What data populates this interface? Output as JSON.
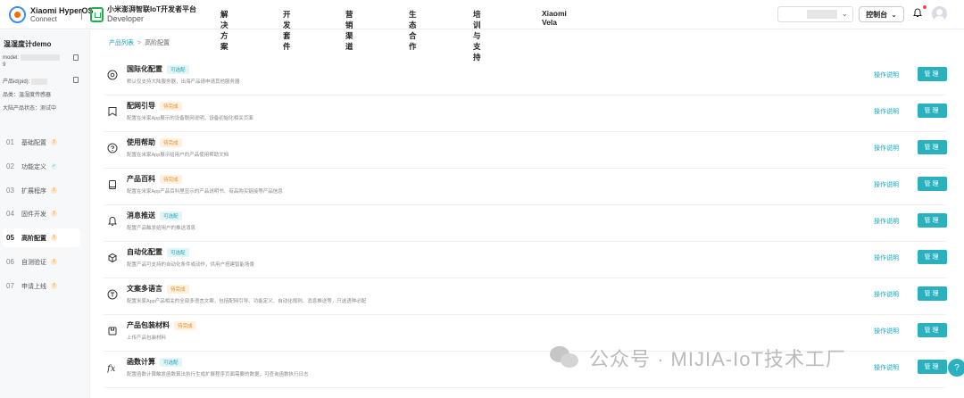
{
  "header": {
    "brand1_line1": "Xiaomi HyperOS",
    "brand1_line2": "Connect",
    "brand2_line1": "小米澎湃智联IoT开发者平台",
    "brand2_line2": "Developer",
    "nav": [
      "解决方案",
      "开发套件",
      "营销渠道",
      "生态合作",
      "培训与支持",
      "Xiaomi Vela"
    ],
    "console_label": "控制台"
  },
  "sidebar": {
    "product_title": "温湿度计demo",
    "model_label": "model:",
    "model_suffix": "9",
    "pid_label": "产品id(pid):",
    "category": "品类：温湿度传感器",
    "status": "大陆产品状态：测试中",
    "steps": [
      {
        "num": "01",
        "label": "基础配置",
        "state": "warn"
      },
      {
        "num": "02",
        "label": "功能定义",
        "state": "ok"
      },
      {
        "num": "03",
        "label": "扩展程序",
        "state": "warn"
      },
      {
        "num": "04",
        "label": "固件开发",
        "state": "warn"
      },
      {
        "num": "05",
        "label": "高阶配置",
        "state": "warn",
        "active": true
      },
      {
        "num": "06",
        "label": "自测验证",
        "state": "warn"
      },
      {
        "num": "07",
        "label": "申请上线",
        "state": "warn"
      }
    ]
  },
  "breadcrumb": {
    "parent": "产品列表",
    "current": "高阶配置"
  },
  "rows": [
    {
      "icon": "globe-icon",
      "title": "国际化配置",
      "tag": "可选配",
      "tag_type": "opt",
      "desc": "默认仅支持大陆服务器，出海产品请申请其他服务器"
    },
    {
      "icon": "network-guide-icon",
      "title": "配网引导",
      "tag": "待完成",
      "tag_type": "todo",
      "desc": "配置在米家App展示的设备联网说明，设备初始化相关页面"
    },
    {
      "icon": "help-circle-icon",
      "title": "使用帮助",
      "tag": "待完成",
      "tag_type": "todo",
      "desc": "配置在米家App展示给用户的产品使用帮助文档"
    },
    {
      "icon": "book-icon",
      "title": "产品百科",
      "tag": "待完成",
      "tag_type": "todo",
      "desc": "配置在米家App产品百科里显示的产品说明书、有品购买链接等产品信息"
    },
    {
      "icon": "bell-icon",
      "title": "消息推送",
      "tag": "可选配",
      "tag_type": "opt",
      "desc": "配置产品触发给用户的推送消息"
    },
    {
      "icon": "cube-icon",
      "title": "自动化配置",
      "tag": "可选配",
      "tag_type": "opt",
      "desc": "配置产品可支持的自动化条件或动作，供用户搭建智能场景"
    },
    {
      "icon": "translate-icon",
      "title": "文案多语言",
      "tag": "待完成",
      "tag_type": "todo",
      "desc": "配置米家App产品相关的全部多语言文案，包括配网引导、功能定义、自动化规则、消息推送等，只选语种必配"
    },
    {
      "icon": "package-icon",
      "title": "产品包装材料",
      "tag": "待完成",
      "tag_type": "todo",
      "desc": "上传产品包装材料"
    },
    {
      "icon": "function-icon",
      "title": "函数计算",
      "tag": "可选配",
      "tag_type": "opt",
      "desc": "配置函数计算触发函数算法执行生成扩展程序页面需要的数据，可查询函数执行日志"
    }
  ],
  "row_help_label": "操作说明",
  "row_manage_label": "管理",
  "watermark": "公众号 · MIJIA-IoT技术工厂",
  "colors": {
    "accent": "#2bb0be",
    "link": "#1ea6bb",
    "warn": "#f08a24"
  }
}
